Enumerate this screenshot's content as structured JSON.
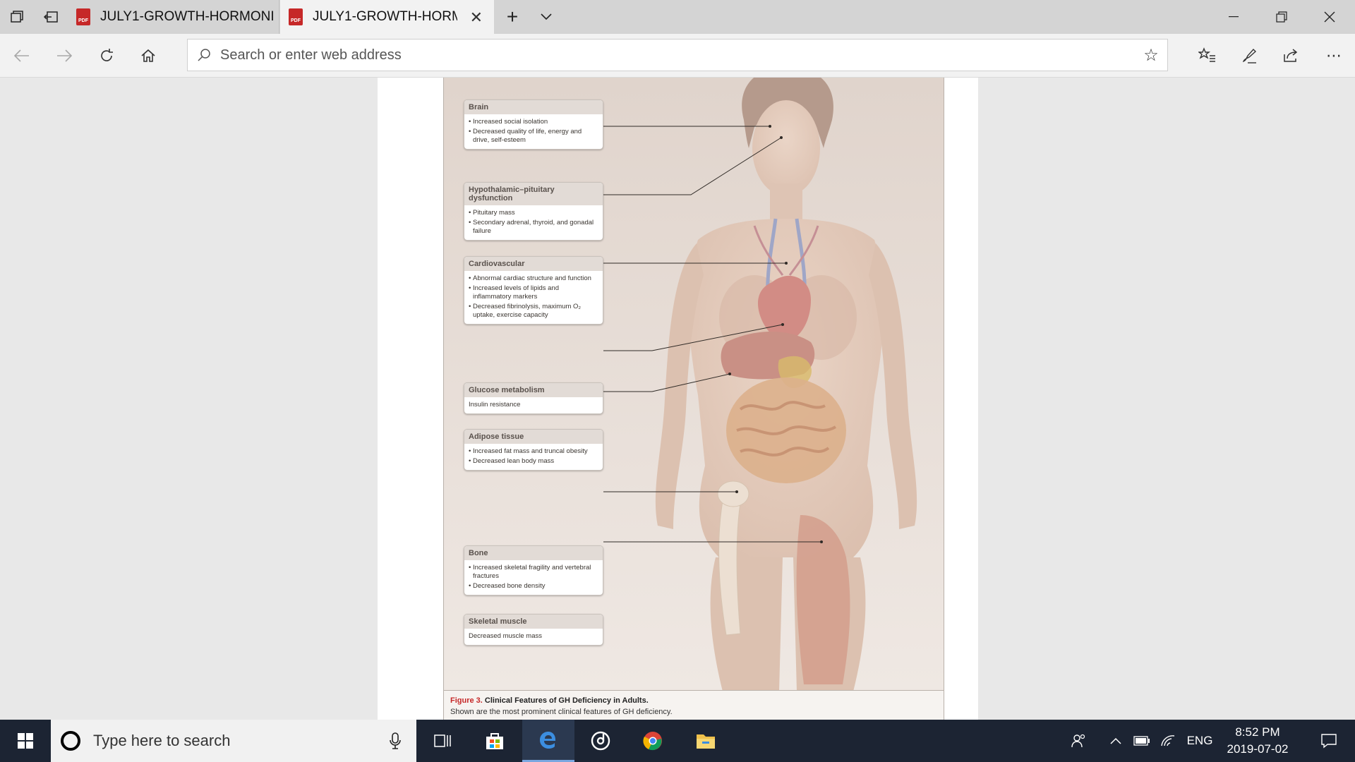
{
  "browser": {
    "tabs": [
      {
        "label": "JULY1-GROWTH-HORMONI",
        "active": false,
        "icon": "pdf-icon"
      },
      {
        "label": "JULY1-GROWTH-HORM",
        "active": true,
        "icon": "pdf-icon"
      }
    ],
    "address_placeholder": "Search or enter web address"
  },
  "figure": {
    "callouts": [
      {
        "title": "Brain",
        "items": [
          "Increased social isolation",
          "Decreased quality of life, energy and drive, self-esteem"
        ]
      },
      {
        "title": "Hypothalamic–pituitary dysfunction",
        "items": [
          "Pituitary mass",
          "Secondary adrenal, thyroid, and gonadal failure"
        ]
      },
      {
        "title": "Cardiovascular",
        "items": [
          "Abnormal cardiac structure and function",
          "Increased levels of lipids and inflammatory markers",
          "Decreased fibrinolysis, maximum O₂ uptake, exercise capacity"
        ]
      },
      {
        "title": "Glucose metabolism",
        "items": [
          "Insulin resistance"
        ]
      },
      {
        "title": "Adipose tissue",
        "items": [
          "Increased fat mass and truncal obesity",
          "Decreased lean body mass"
        ]
      },
      {
        "title": "Bone",
        "items": [
          "Increased skeletal fragility and vertebral fractures",
          "Decreased bone density"
        ]
      },
      {
        "title": "Skeletal muscle",
        "items": [
          "Decreased muscle mass"
        ]
      }
    ],
    "caption": {
      "figure_label": "Figure 3.",
      "title": "Clinical Features of GH Deficiency in Adults.",
      "text": "Shown are the most prominent clinical features of GH deficiency."
    }
  },
  "taskbar": {
    "search_placeholder": "Type here to search",
    "language": "ENG",
    "time": "8:52 PM",
    "date": "2019-07-02"
  },
  "colors": {
    "accent": "#0078d7",
    "figure_label": "#c62828",
    "taskbar": "#1c2433"
  }
}
